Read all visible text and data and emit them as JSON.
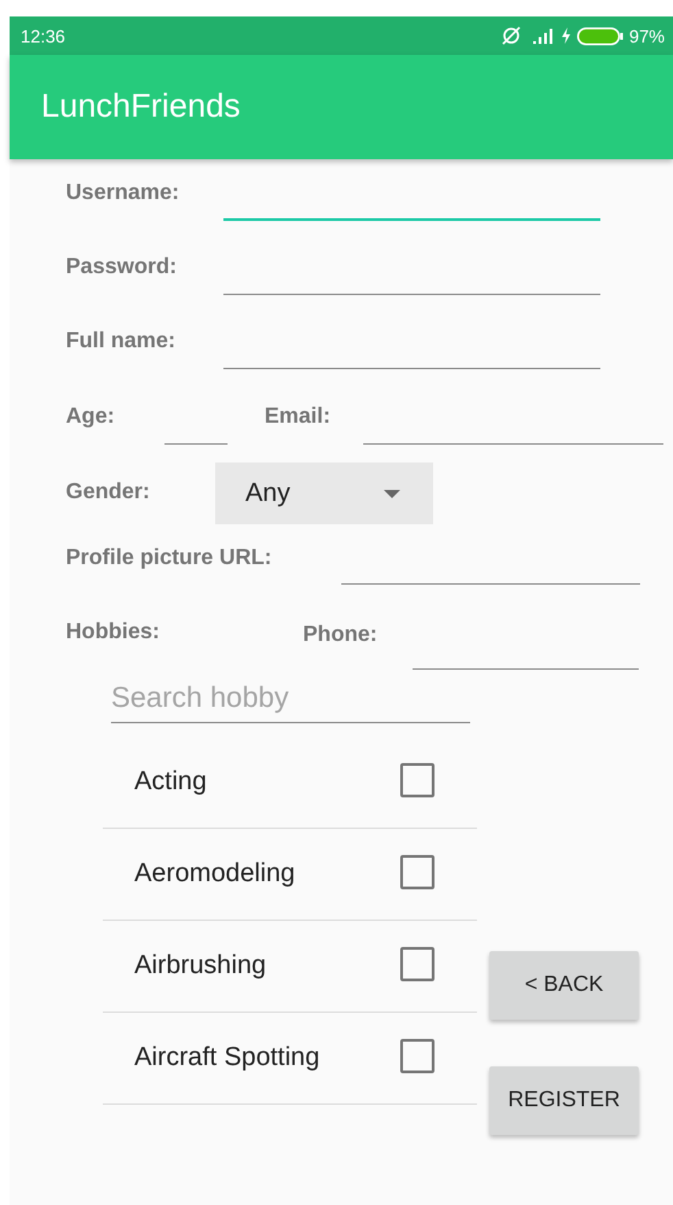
{
  "status_bar": {
    "time": "12:36",
    "battery": "97%"
  },
  "app_bar": {
    "title": "LunchFriends"
  },
  "form": {
    "username": {
      "label": "Username:",
      "focused": true
    },
    "password": {
      "label": "Password:",
      "focused": false
    },
    "full_name": {
      "label": "Full name:",
      "focused": false
    },
    "age": {
      "label": "Age:",
      "focused": false
    },
    "email": {
      "label": "Email:",
      "focused": false
    },
    "gender": {
      "label": "Gender:",
      "value": "Any"
    },
    "profile_picture_url": {
      "label": "Profile picture URL:",
      "focused": false
    },
    "hobbies_label": "Hobbies:",
    "phone": {
      "label": "Phone:",
      "focused": false
    },
    "hobby_search": {
      "placeholder": "Search hobby"
    },
    "hobbies": [
      {
        "name": "Acting",
        "checked": false
      },
      {
        "name": "Aeromodeling",
        "checked": false
      },
      {
        "name": "Airbrushing",
        "checked": false
      },
      {
        "name": "Aircraft Spotting",
        "checked": false
      }
    ],
    "buttons": [
      "< BACK",
      "REGISTER"
    ]
  }
}
